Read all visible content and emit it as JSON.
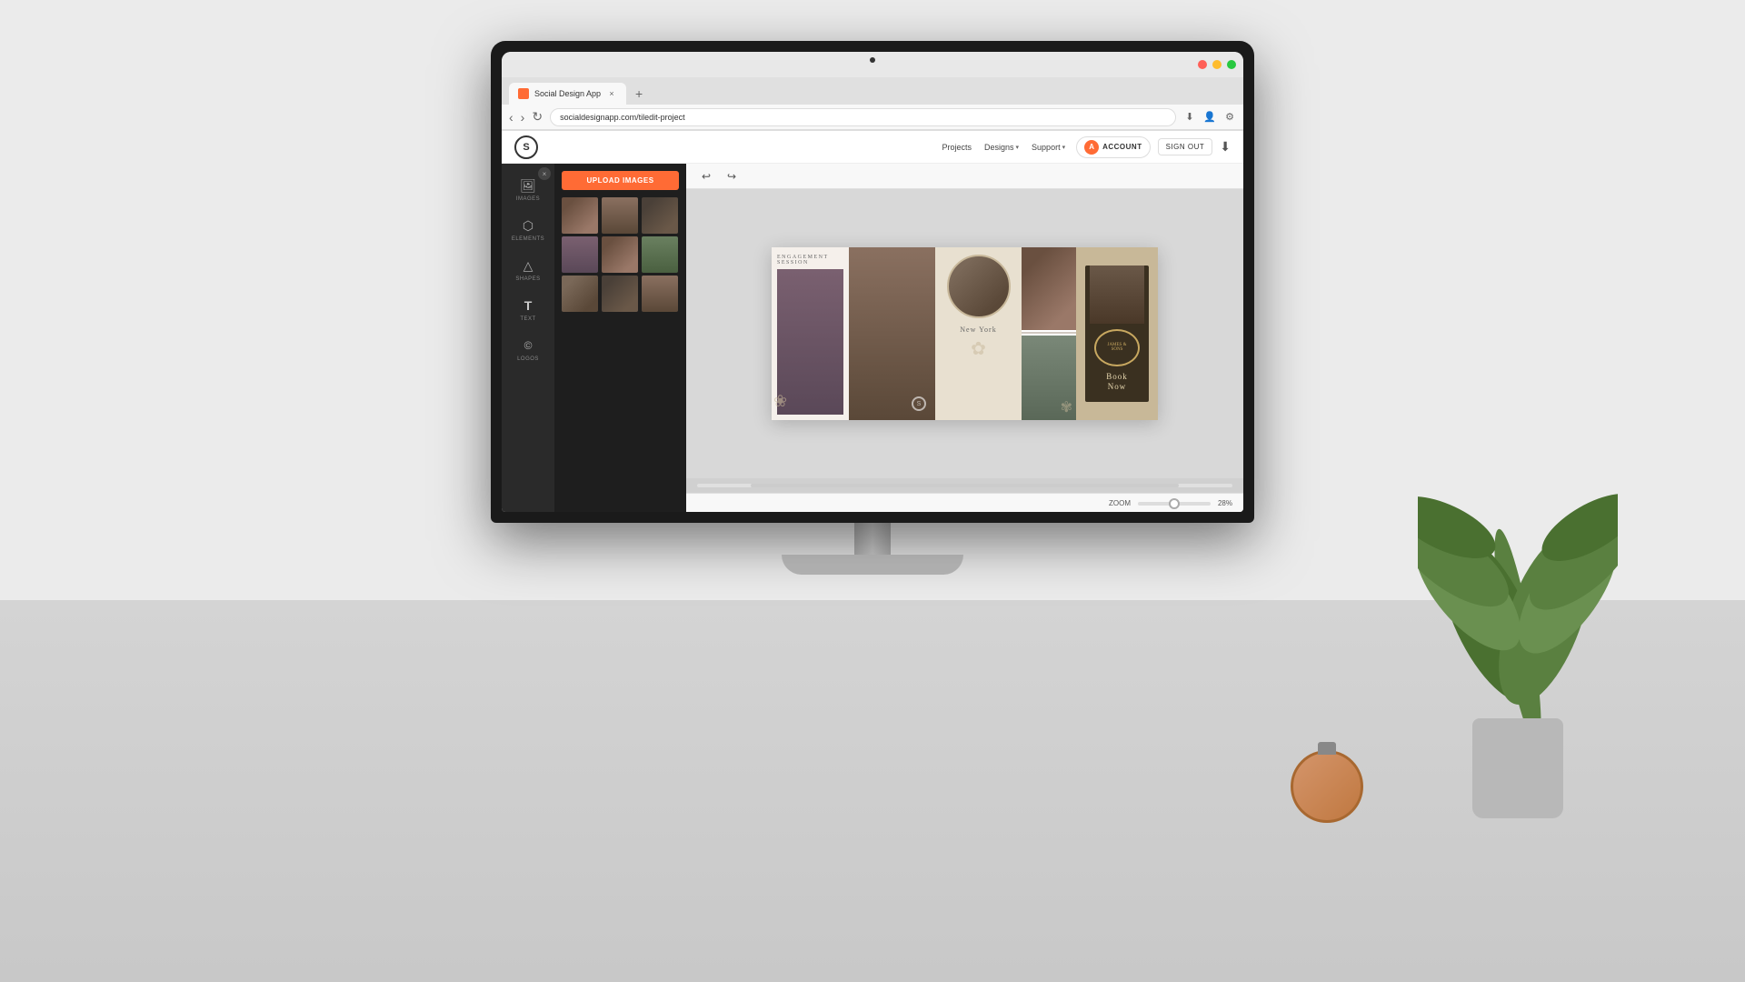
{
  "browser": {
    "tab_title": "Social Design App",
    "url": "socialdesignapp.com/tiledit-project",
    "window_buttons": [
      "close",
      "minimize",
      "maximize"
    ]
  },
  "header": {
    "logo_letter": "S",
    "nav": {
      "projects": "Projects",
      "designs": "Designs",
      "designs_arrow": "▾",
      "support": "Support",
      "support_arrow": "▾"
    },
    "account_label": "AccounT",
    "account_letter": "A",
    "sign_out_label": "SIGN OUT",
    "download_icon": "⬇"
  },
  "sidebar": {
    "close_icon": "×",
    "items": [
      {
        "icon": "🖼",
        "label": "IMAGES"
      },
      {
        "icon": "⬡",
        "label": "ELEMENTS"
      },
      {
        "icon": "△",
        "label": "SHAPES"
      },
      {
        "icon": "T",
        "label": "TEXT"
      },
      {
        "icon": "©",
        "label": "LOGOS"
      }
    ]
  },
  "images_panel": {
    "upload_button": "UPLOAD IMAGES",
    "thumbnails": [
      {
        "color": "#7a6858"
      },
      {
        "color": "#5a4838"
      },
      {
        "color": "#6a5040"
      },
      {
        "color": "#8a6858"
      },
      {
        "color": "#6a7868"
      },
      {
        "color": "#9a8070"
      },
      {
        "color": "#5a4040"
      },
      {
        "color": "#7a6068"
      },
      {
        "color": "#8a7060"
      }
    ]
  },
  "canvas": {
    "undo_icon": "↩",
    "redo_icon": "↪",
    "design_cards": [
      {
        "id": "card1",
        "type": "engagement-session",
        "title": "Engagement Session",
        "bg_color": "#f5f0eb"
      },
      {
        "id": "card2",
        "type": "couple-photo",
        "bg_color": "#8a7060"
      },
      {
        "id": "card3",
        "type": "new-york",
        "title": "New York",
        "bg_color": "#e8e0d0"
      },
      {
        "id": "card4",
        "type": "two-photos",
        "bg_color": "#888"
      },
      {
        "id": "card5",
        "type": "book-now",
        "title": "Book",
        "subtitle": "Now",
        "brand": "James & Sons",
        "bg_color": "#c8b898"
      }
    ],
    "zoom_label": "ZOOM",
    "zoom_value": "28%"
  },
  "toolbar": {
    "undo": "↩",
    "redo": "↪",
    "download": "⬇"
  }
}
